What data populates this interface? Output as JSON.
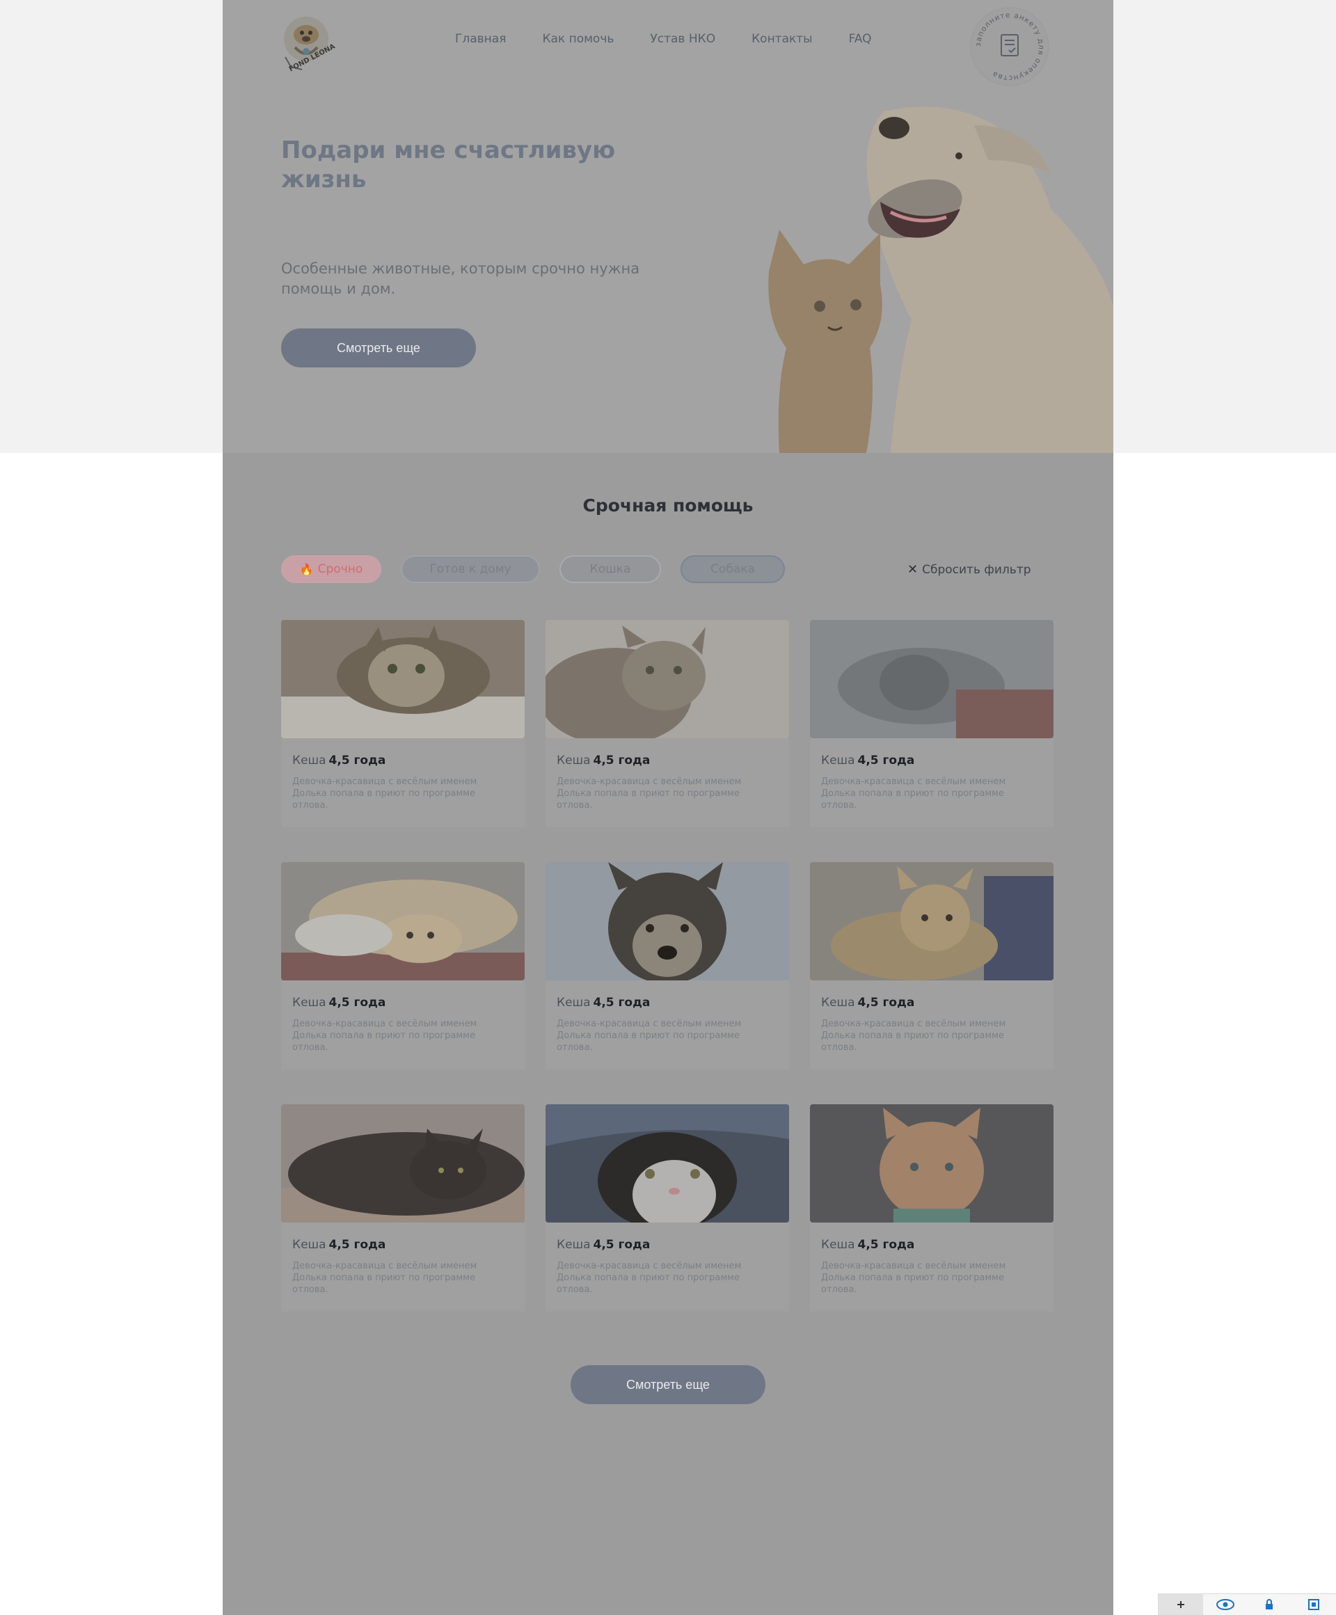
{
  "header": {
    "logo_text": "FOND LEONA",
    "nav": [
      {
        "label": "Главная"
      },
      {
        "label": "Как помочь"
      },
      {
        "label": "Устав НКО"
      },
      {
        "label": "Контакты"
      },
      {
        "label": "FAQ"
      }
    ],
    "stamp_text": "заполните анкету для опекунства"
  },
  "hero": {
    "title": "Подари мне счастливую жизнь",
    "subtitle": "Особенные животные, которым срочно нужна помощь и дом.",
    "button_label": "Смотреть еще"
  },
  "urgent": {
    "title": "Срочная помощь",
    "filters": [
      {
        "label": "Срочно",
        "icon": "flame-icon"
      },
      {
        "label": "Готов к дому"
      },
      {
        "label": "Кошка"
      },
      {
        "label": "Собака"
      }
    ],
    "reset_label": "Сбросить фильтр",
    "cards": [
      {
        "name": "Кеша",
        "age": "4,5 года",
        "desc": "Девочка-красавица с весёлым именем Долька попала в приют по программе отлова.",
        "photo": "tabby-cat-photo"
      },
      {
        "name": "Кеша",
        "age": "4,5 года",
        "desc": "Девочка-красавица с весёлым именем Долька попала в приют по программе отлова.",
        "photo": "tabby-cat-photo"
      },
      {
        "name": "Кеша",
        "age": "4,5 года",
        "desc": "Девочка-красавица с весёлым именем Долька попала в приют по программе отлова.",
        "photo": "grey-dog-photo"
      },
      {
        "name": "Кеша",
        "age": "4,5 года",
        "desc": "Девочка-красавица с весёлым именем Долька попала в приют по программе отлова.",
        "photo": "retriever-photo"
      },
      {
        "name": "Кеша",
        "age": "4,5 года",
        "desc": "Девочка-красавица с весёлым именем Долька попала в приют по программе отлова.",
        "photo": "husky-photo"
      },
      {
        "name": "Кеша",
        "age": "4,5 года",
        "desc": "Девочка-красавица с весёлым именем Долька попала в приют по программе отлова.",
        "photo": "yellow-dog-photo"
      },
      {
        "name": "Кеша",
        "age": "4,5 года",
        "desc": "Девочка-красавица с весёлым именем Долька попала в приют по программе отлова.",
        "photo": "black-cat-photo"
      },
      {
        "name": "Кеша",
        "age": "4,5 года",
        "desc": "Девочка-красавица с весёлым именем Долька попала в приют по программе отлова.",
        "photo": "tuxedo-cat-photo"
      },
      {
        "name": "Кеша",
        "age": "4,5 года",
        "desc": "Девочка-красавица с весёлым именем Долька попала в приют по программе отлова.",
        "photo": "ginger-cat-photo"
      }
    ],
    "more_label": "Смотреть еще"
  },
  "toolbar": {
    "icons": [
      "plus-icon",
      "eye-icon",
      "lock-icon",
      "frame-icon"
    ]
  },
  "colors": {
    "accent_button": "#6f7685",
    "urgent_chip": "#d36a72",
    "title": "#6f7785"
  }
}
